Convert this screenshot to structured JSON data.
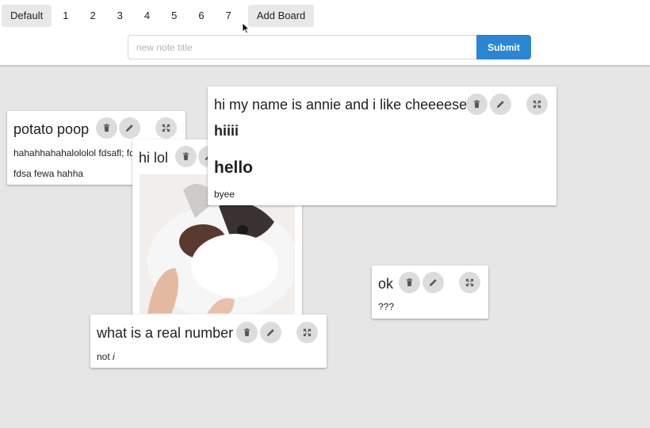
{
  "boards": [
    "Default",
    "1",
    "2",
    "3",
    "4",
    "5",
    "6",
    "7",
    "Add Board"
  ],
  "form": {
    "placeholder": "new note title",
    "submit_label": "Submit"
  },
  "notes": {
    "potato": {
      "title": "potato poop",
      "line1": "hahahhahahalololol fdsafl; fdp",
      "line2": "fdsa fewa hahha"
    },
    "hilol": {
      "title": "hi lol"
    },
    "annie": {
      "title": "hi my name is annie and i like cheeeese",
      "h1": "hiiii",
      "h2": "hello",
      "text": "byee"
    },
    "ok": {
      "title": "ok",
      "text": "???"
    },
    "real": {
      "title": "what is a real number",
      "text_prefix": "not ",
      "text_italic": "i"
    }
  },
  "colors": {
    "accent": "#2a85d4",
    "background": "#e6e6e6",
    "icon_button": "#dcdcdc"
  },
  "icons": [
    "trash-icon",
    "pencil-icon",
    "expand-icon",
    "mouse-cursor-icon"
  ]
}
